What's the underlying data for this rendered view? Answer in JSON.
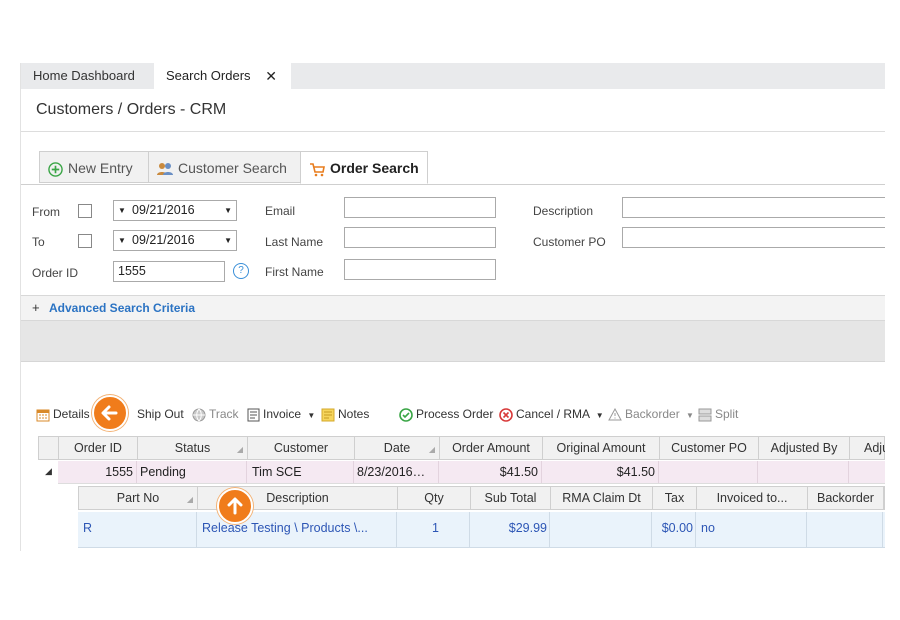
{
  "window": {
    "tabs": [
      {
        "label": "Home Dashboard"
      },
      {
        "label": "Search Orders",
        "close": "✕"
      }
    ],
    "title": "Customers / Orders - CRM"
  },
  "subtabs": [
    {
      "label": "New Entry",
      "icon": "plus-circle-icon"
    },
    {
      "label": "Customer Search",
      "icon": "users-icon"
    },
    {
      "label": "Order Search",
      "icon": "cart-icon",
      "active": true
    }
  ],
  "form": {
    "from_label": "From",
    "from_date": "09/21/2016",
    "to_label": "To",
    "to_date": "09/21/2016",
    "order_id_label": "Order ID",
    "order_id_value": "1555",
    "help": "?",
    "email_label": "Email",
    "last_name_label": "Last Name",
    "first_name_label": "First Name",
    "description_label": "Description",
    "customer_po_label": "Customer PO"
  },
  "advanced": {
    "toggle": "+",
    "label": "Advanced Search Criteria"
  },
  "toolbar": {
    "details": "Details",
    "ship_out": "Ship Out",
    "track": "Track",
    "invoice": "Invoice",
    "notes": "Notes",
    "process_order": "Process Order",
    "cancel_rma": "Cancel / RMA",
    "backorder": "Backorder",
    "split": "Split"
  },
  "orders_grid": {
    "headers": [
      "Order ID",
      "Status",
      "Customer",
      "Date",
      "Order Amount",
      "Original Amount",
      "Customer PO",
      "Adjusted By",
      "Adju"
    ],
    "rows": [
      {
        "expand": "◢",
        "order_id": "1555",
        "status": "Pending",
        "customer": "Tim SCE",
        "date": "8/23/2016…",
        "order_amount": "$41.50",
        "original_amount": "$41.50",
        "customer_po": "",
        "adjusted_by": ""
      }
    ]
  },
  "detail_grid": {
    "headers": [
      "Part No",
      "Description",
      "Qty",
      "Sub Total",
      "RMA Claim Dt",
      "Tax",
      "Invoiced to...",
      "Backorder"
    ],
    "rows": [
      {
        "part_no": "R",
        "description": "Release Testing \\ Products \\...",
        "qty": "1",
        "sub_total": "$29.99",
        "rma_claim_dt": "",
        "tax": "$0.00",
        "invoiced_to": "no",
        "backorder": ""
      }
    ]
  },
  "callouts": [
    {
      "icon": "arrow-left-icon",
      "glyph": "←"
    },
    {
      "icon": "arrow-up-icon",
      "glyph": "↑"
    }
  ],
  "colors": {
    "accent_orange": "#f07c1b",
    "link_blue": "#2b73c3",
    "row_highlight": "#f5e9f2",
    "detail_row": "#eaf3fb"
  }
}
